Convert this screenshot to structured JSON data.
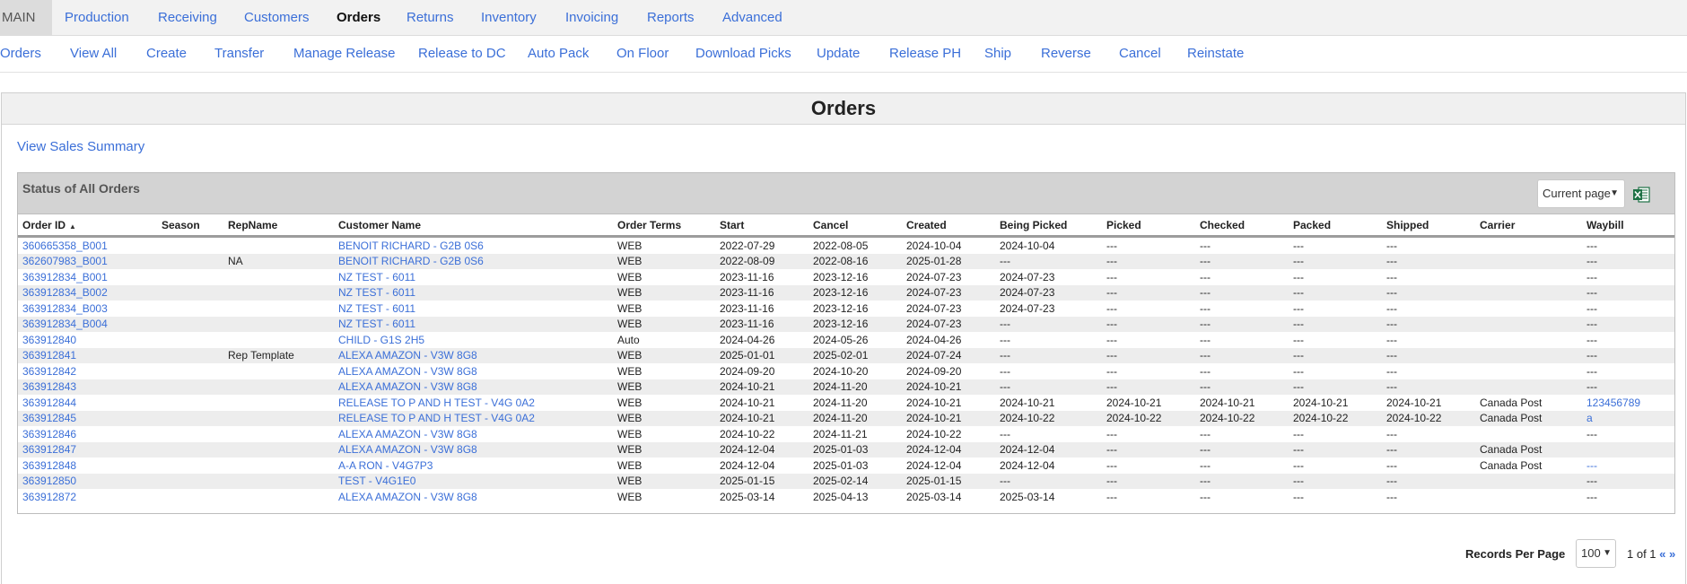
{
  "main_nav": {
    "items": [
      "MAIN",
      "Production",
      "Receiving",
      "Customers",
      "Orders",
      "Returns",
      "Inventory",
      "Invoicing",
      "Reports",
      "Advanced"
    ],
    "active": "Orders"
  },
  "sub_nav": {
    "items": [
      "Orders",
      "View All",
      "Create",
      "Transfer",
      "Manage Release",
      "Release to DC",
      "Auto Pack",
      "On Floor",
      "Download Picks",
      "Update",
      "Release PH",
      "Ship",
      "Reverse",
      "Cancel",
      "Reinstate"
    ]
  },
  "page": {
    "title": "Orders",
    "sales_summary_link": "View Sales Summary"
  },
  "status": {
    "title": "Status of All Orders",
    "export_scope": "Current page",
    "export_icon": "excel-icon"
  },
  "table": {
    "columns": [
      "Order ID",
      "Season",
      "RepName",
      "Customer Name",
      "Order Terms",
      "Start",
      "Cancel",
      "Created",
      "Being Picked",
      "Picked",
      "Checked",
      "Packed",
      "Shipped",
      "Carrier",
      "Waybill"
    ],
    "sort_column": "Order ID",
    "rows": [
      [
        "360665358_B001",
        "",
        "",
        "BENOIT RICHARD - G2B 0S6",
        "WEB",
        "2022-07-29",
        "2022-08-05",
        "2024-10-04",
        "2024-10-04",
        "---",
        "---",
        "---",
        "---",
        "",
        "---"
      ],
      [
        "362607983_B001",
        "",
        "NA",
        "BENOIT RICHARD - G2B 0S6",
        "WEB",
        "2022-08-09",
        "2022-08-16",
        "2025-01-28",
        "---",
        "---",
        "---",
        "---",
        "---",
        "",
        "---"
      ],
      [
        "363912834_B001",
        "",
        "",
        "NZ TEST - 6011",
        "WEB",
        "2023-11-16",
        "2023-12-16",
        "2024-07-23",
        "2024-07-23",
        "---",
        "---",
        "---",
        "---",
        "",
        "---"
      ],
      [
        "363912834_B002",
        "",
        "",
        "NZ TEST - 6011",
        "WEB",
        "2023-11-16",
        "2023-12-16",
        "2024-07-23",
        "2024-07-23",
        "---",
        "---",
        "---",
        "---",
        "",
        "---"
      ],
      [
        "363912834_B003",
        "",
        "",
        "NZ TEST - 6011",
        "WEB",
        "2023-11-16",
        "2023-12-16",
        "2024-07-23",
        "2024-07-23",
        "---",
        "---",
        "---",
        "---",
        "",
        "---"
      ],
      [
        "363912834_B004",
        "",
        "",
        "NZ TEST - 6011",
        "WEB",
        "2023-11-16",
        "2023-12-16",
        "2024-07-23",
        "---",
        "---",
        "---",
        "---",
        "---",
        "",
        "---"
      ],
      [
        "363912840",
        "",
        "",
        "CHILD - G1S 2H5",
        "Auto",
        "2024-04-26",
        "2024-05-26",
        "2024-04-26",
        "---",
        "---",
        "---",
        "---",
        "---",
        "",
        "---"
      ],
      [
        "363912841",
        "",
        "Rep Template",
        "ALEXA AMAZON - V3W 8G8",
        "WEB",
        "2025-01-01",
        "2025-02-01",
        "2024-07-24",
        "---",
        "---",
        "---",
        "---",
        "---",
        "",
        "---"
      ],
      [
        "363912842",
        "",
        "",
        "ALEXA AMAZON - V3W 8G8",
        "WEB",
        "2024-09-20",
        "2024-10-20",
        "2024-09-20",
        "---",
        "---",
        "---",
        "---",
        "---",
        "",
        "---"
      ],
      [
        "363912843",
        "",
        "",
        "ALEXA AMAZON - V3W 8G8",
        "WEB",
        "2024-10-21",
        "2024-11-20",
        "2024-10-21",
        "---",
        "---",
        "---",
        "---",
        "---",
        "",
        "---"
      ],
      [
        "363912844",
        "",
        "",
        "RELEASE TO P AND H TEST - V4G 0A2",
        "WEB",
        "2024-10-21",
        "2024-11-20",
        "2024-10-21",
        "2024-10-21",
        "2024-10-21",
        "2024-10-21",
        "2024-10-21",
        "2024-10-21",
        "Canada Post",
        "123456789"
      ],
      [
        "363912845",
        "",
        "",
        "RELEASE TO P AND H TEST - V4G 0A2",
        "WEB",
        "2024-10-21",
        "2024-11-20",
        "2024-10-21",
        "2024-10-22",
        "2024-10-22",
        "2024-10-22",
        "2024-10-22",
        "2024-10-22",
        "Canada Post",
        "a"
      ],
      [
        "363912846",
        "",
        "",
        "ALEXA AMAZON - V3W 8G8",
        "WEB",
        "2024-10-22",
        "2024-11-21",
        "2024-10-22",
        "---",
        "---",
        "---",
        "---",
        "---",
        "",
        "---"
      ],
      [
        "363912847",
        "",
        "",
        "ALEXA AMAZON - V3W 8G8",
        "WEB",
        "2024-12-04",
        "2025-01-03",
        "2024-12-04",
        "2024-12-04",
        "---",
        "---",
        "---",
        "---",
        "Canada Post",
        ""
      ],
      [
        "363912848",
        "",
        "",
        "A-A RON - V4G7P3",
        "WEB",
        "2024-12-04",
        "2025-01-03",
        "2024-12-04",
        "2024-12-04",
        "---",
        "---",
        "---",
        "---",
        "Canada Post",
        "---"
      ],
      [
        "363912850",
        "",
        "",
        "TEST - V4G1E0",
        "WEB",
        "2025-01-15",
        "2025-02-14",
        "2025-01-15",
        "---",
        "---",
        "---",
        "---",
        "---",
        "",
        "---"
      ],
      [
        "363912872",
        "",
        "",
        "ALEXA AMAZON - V3W 8G8",
        "WEB",
        "2025-03-14",
        "2025-04-13",
        "2025-03-14",
        "2025-03-14",
        "---",
        "---",
        "---",
        "---",
        "",
        "---"
      ]
    ],
    "waybill_links": [
      "123456789",
      "a"
    ],
    "waybill_link_row": 14
  },
  "footer": {
    "records_per_page_label": "Records Per Page",
    "records_per_page": "100",
    "page_info": "1 of 1",
    "prev": "«",
    "next": "»"
  },
  "colors": {
    "link": "#3b6fd8",
    "nav_bg": "#f2f2f2",
    "status_header_bg": "#d3d3d3",
    "row_alt": "#ededed",
    "excel_green": "#1e7145"
  }
}
